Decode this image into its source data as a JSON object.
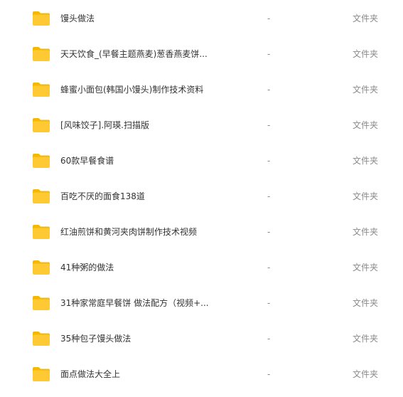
{
  "files": [
    {
      "name": "馒头做法",
      "size": "-",
      "type": "文件夹",
      "icon": "folder-icon"
    },
    {
      "name": "天天饮食_(早餐主题燕麦)葱香燕麦饼...",
      "size": "-",
      "type": "文件夹",
      "icon": "folder-icon"
    },
    {
      "name": "蜂蜜小面包(韩国小馒头)制作技术资料",
      "size": "-",
      "type": "文件夹",
      "icon": "folder-icon"
    },
    {
      "name": "[风味饺子].阿瑛.扫描版",
      "size": "-",
      "type": "文件夹",
      "icon": "folder-icon"
    },
    {
      "name": "60款早餐食谱",
      "size": "-",
      "type": "文件夹",
      "icon": "folder-icon"
    },
    {
      "name": "百吃不厌的面食138道",
      "size": "-",
      "type": "文件夹",
      "icon": "folder-icon"
    },
    {
      "name": "红油煎饼和黄河夹肉饼制作技术视频",
      "size": "-",
      "type": "文件夹",
      "icon": "folder-icon"
    },
    {
      "name": "41种粥的做法",
      "size": "-",
      "type": "文件夹",
      "icon": "folder-icon"
    },
    {
      "name": "31种家常庭早餐饼 做法配方（视频+...",
      "size": "-",
      "type": "文件夹",
      "icon": "folder-icon"
    },
    {
      "name": "35种包子馒头做法",
      "size": "-",
      "type": "文件夹",
      "icon": "folder-icon"
    },
    {
      "name": "面点做法大全上",
      "size": "-",
      "type": "文件夹",
      "icon": "folder-icon"
    }
  ],
  "colors": {
    "folder_body": "#ffc933",
    "folder_tab": "#f5b800",
    "name_text": "#333333",
    "meta_text": "#8a8a8a"
  }
}
